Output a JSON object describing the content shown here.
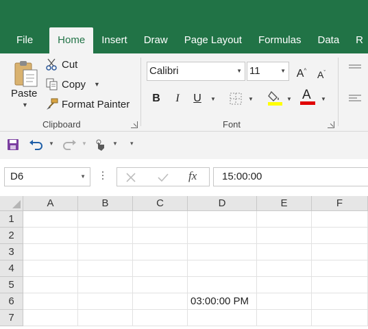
{
  "tabs": [
    "File",
    "Home",
    "Insert",
    "Draw",
    "Page Layout",
    "Formulas",
    "Data",
    "R"
  ],
  "active_tab": "Home",
  "clipboard": {
    "paste_label": "Paste",
    "cut_label": "Cut",
    "copy_label": "Copy",
    "format_painter_label": "Format Painter",
    "group_label": "Clipboard"
  },
  "font": {
    "family": "Calibri",
    "size": "11",
    "group_label": "Font",
    "bold": "B",
    "italic": "I",
    "underline": "U",
    "font_color_glyph": "A"
  },
  "colors": {
    "brand": "#217346",
    "highlight": "#ffff00",
    "font_color": "#e00000",
    "qat_save": "#7b3fa0",
    "qat_undo": "#1f5fa8"
  },
  "formula_bar": {
    "name_box": "D6",
    "fx": "fx",
    "value": "15:00:00"
  },
  "grid": {
    "columns": [
      "A",
      "B",
      "C",
      "D",
      "E",
      "F"
    ],
    "rows": [
      "1",
      "2",
      "3",
      "4",
      "5",
      "6",
      "7"
    ],
    "d6_value": "03:00:00 PM"
  }
}
